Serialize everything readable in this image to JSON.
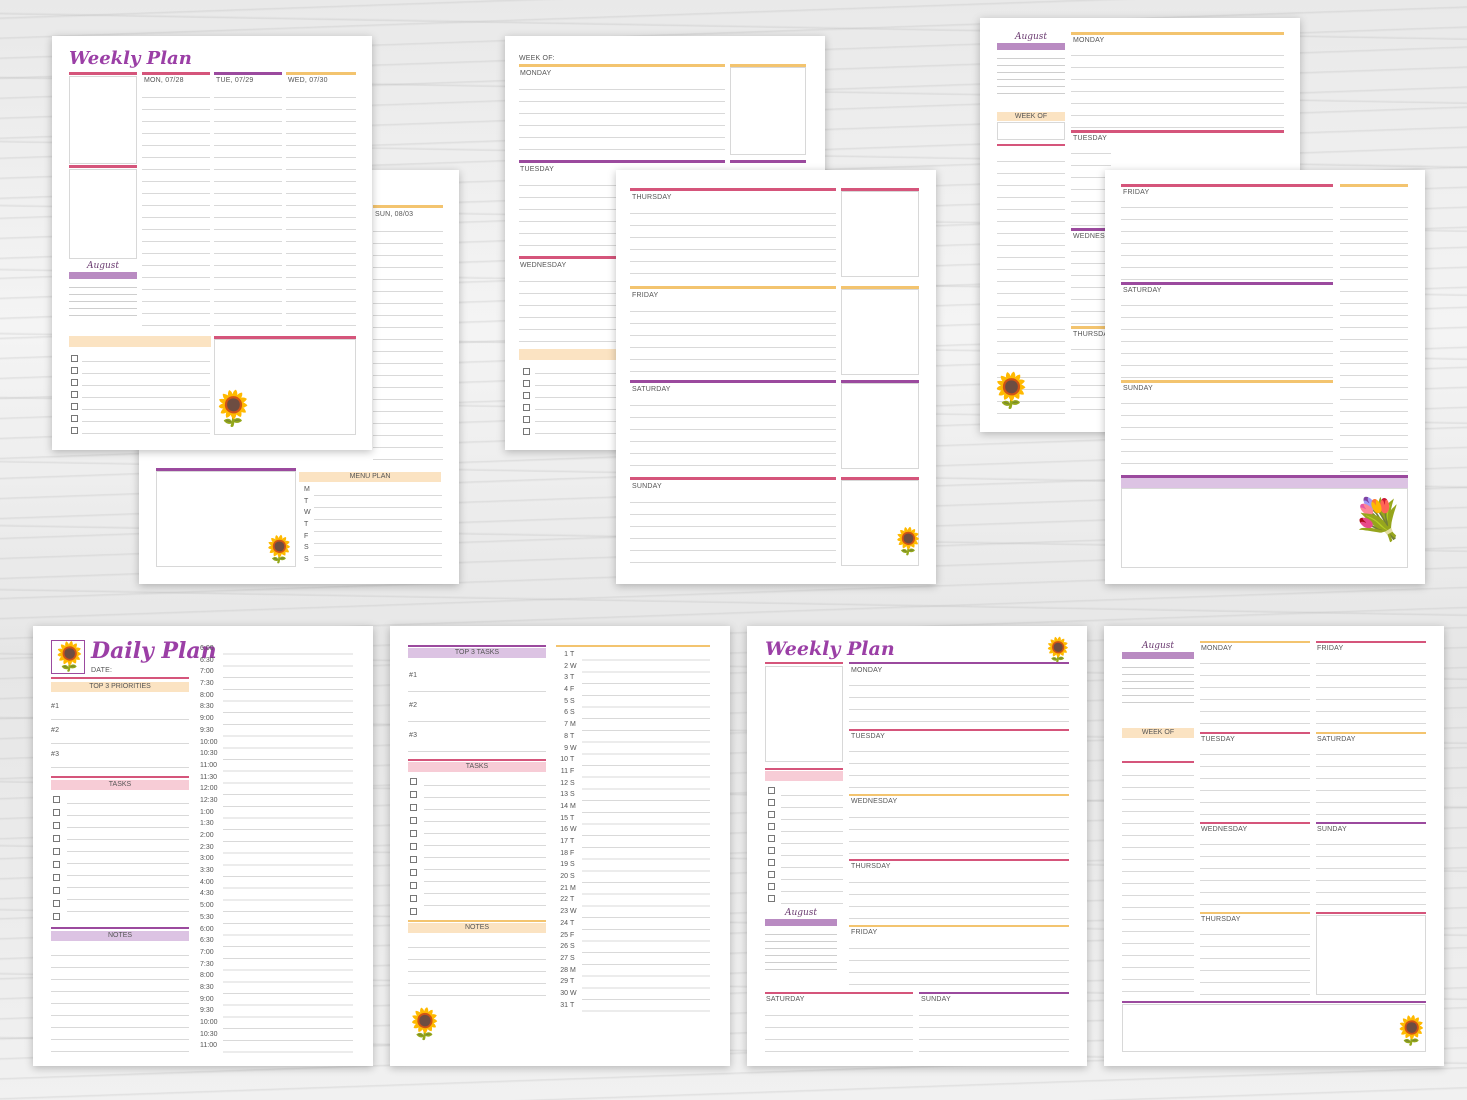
{
  "weekly_plan_1": {
    "title": "Weekly Plan",
    "days": [
      "MON, 07/28",
      "TUE, 07/29",
      "WED, 07/30"
    ],
    "month": "August"
  },
  "weekly_plan_back": {
    "sun": "SUN, 08/03",
    "menu_plan": "MENU PLAN",
    "menu_days": [
      "M",
      "T",
      "W",
      "T",
      "F",
      "S",
      "S"
    ]
  },
  "week_of_page": {
    "week_of": "WEEK OF:",
    "days": [
      "MONDAY",
      "TUESDAY",
      "WEDNESDAY"
    ]
  },
  "thu_sun_page": {
    "days": [
      "THURSDAY",
      "FRIDAY",
      "SATURDAY",
      "SUNDAY"
    ]
  },
  "vertical_week": {
    "month": "August",
    "week_of": "WEEK OF",
    "days": [
      "MONDAY",
      "TUESDAY",
      "WEDNESDAY",
      "THURSDAY"
    ]
  },
  "fri_sun_page": {
    "days": [
      "FRIDAY",
      "SATURDAY",
      "SUNDAY"
    ]
  },
  "daily_plan": {
    "title": "Daily Plan",
    "date": "DATE:",
    "priorities": "TOP 3 PRIORITIES",
    "nums": [
      "#1",
      "#2",
      "#3"
    ],
    "tasks": "TASKS",
    "notes": "NOTES",
    "times": [
      "6:00",
      "6:30",
      "7:00",
      "7:30",
      "8:00",
      "8:30",
      "9:00",
      "9:30",
      "10:00",
      "10:30",
      "11:00",
      "11:30",
      "12:00",
      "12:30",
      "1:00",
      "1:30",
      "2:00",
      "2:30",
      "3:00",
      "3:30",
      "4:00",
      "4:30",
      "5:00",
      "5:30",
      "6:00",
      "6:30",
      "7:00",
      "7:30",
      "8:00",
      "8:30",
      "9:00",
      "9:30",
      "10:00",
      "10:30",
      "11:00"
    ]
  },
  "monthly_tasks": {
    "top3": "TOP 3 TASKS",
    "nums": [
      "#1",
      "#2",
      "#3"
    ],
    "tasks": "TASKS",
    "notes": "NOTES",
    "dates": [
      "1",
      "2",
      "3",
      "4",
      "5",
      "6",
      "7",
      "8",
      "9",
      "10",
      "11",
      "12",
      "13",
      "14",
      "15",
      "16",
      "17",
      "18",
      "19",
      "20",
      "21",
      "22",
      "23",
      "24",
      "25",
      "26",
      "27",
      "28",
      "29",
      "30",
      "31"
    ],
    "dows": [
      "T",
      "W",
      "T",
      "F",
      "S",
      "S",
      "M",
      "T",
      "W",
      "T",
      "F",
      "S",
      "S",
      "M",
      "T",
      "W",
      "T",
      "F",
      "S",
      "S",
      "M",
      "T",
      "W",
      "T",
      "F",
      "S",
      "S",
      "M",
      "T",
      "W",
      "T"
    ]
  },
  "weekly_plan_2": {
    "title": "Weekly Plan",
    "days": [
      "MONDAY",
      "TUESDAY",
      "WEDNESDAY",
      "THURSDAY",
      "FRIDAY",
      "SATURDAY",
      "SUNDAY"
    ],
    "month": "August"
  },
  "grid_week": {
    "month": "August",
    "week_of": "WEEK OF",
    "days": [
      "MONDAY",
      "FRIDAY",
      "TUESDAY",
      "SATURDAY",
      "WEDNESDAY",
      "SUNDAY",
      "THURSDAY"
    ]
  },
  "colors": {
    "pink": "#d5557b",
    "purple": "#9b4a9e",
    "orange": "#f3c46f",
    "lavender": "#dcc3e3"
  },
  "icons": [
    "sunflower-hat-icon",
    "sunflower-teacup-icon",
    "sunflower-vase-icon",
    "flower-bouquet-icon"
  ]
}
